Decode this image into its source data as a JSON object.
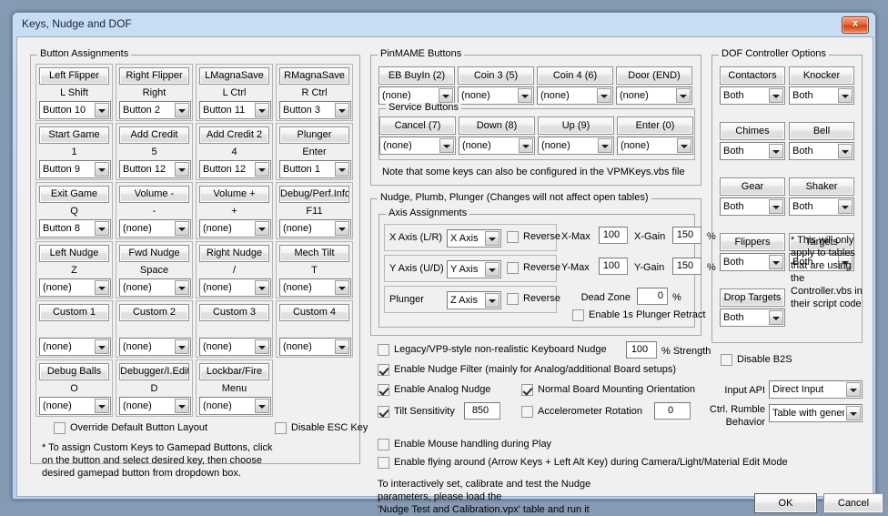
{
  "window": {
    "title": "Keys, Nudge and DOF",
    "close_label": "x"
  },
  "button_assignments": {
    "caption": "Button Assignments",
    "cells": [
      {
        "action": "Left Flipper",
        "key": "L Shift",
        "device": "Button 10"
      },
      {
        "action": "Right Flipper",
        "key": "Right",
        "device": "Button 2"
      },
      {
        "action": "LMagnaSave",
        "key": "L Ctrl",
        "device": "Button 11"
      },
      {
        "action": "RMagnaSave",
        "key": "R Ctrl",
        "device": "Button 3"
      },
      {
        "action": "Start Game",
        "key": "1",
        "device": "Button 9"
      },
      {
        "action": "Add Credit",
        "key": "5",
        "device": "Button 12"
      },
      {
        "action": "Add Credit 2",
        "key": "4",
        "device": "Button 12"
      },
      {
        "action": "Plunger",
        "key": "Enter",
        "device": "Button 1"
      },
      {
        "action": "Exit Game",
        "key": "Q",
        "device": "Button 8"
      },
      {
        "action": "Volume -",
        "key": "-",
        "device": "(none)"
      },
      {
        "action": "Volume +",
        "key": "+",
        "device": "(none)"
      },
      {
        "action": "Debug/Perf.Info",
        "key": "F11",
        "device": "(none)"
      },
      {
        "action": "Left Nudge",
        "key": "Z",
        "device": "(none)"
      },
      {
        "action": "Fwd Nudge",
        "key": "Space",
        "device": "(none)"
      },
      {
        "action": "Right Nudge",
        "key": "/",
        "device": "(none)"
      },
      {
        "action": "Mech Tilt",
        "key": "T",
        "device": "(none)"
      },
      {
        "action": "Custom 1",
        "key": "",
        "device": "(none)"
      },
      {
        "action": "Custom 2",
        "key": "",
        "device": "(none)"
      },
      {
        "action": "Custom 3",
        "key": "",
        "device": "(none)"
      },
      {
        "action": "Custom 4",
        "key": "",
        "device": "(none)"
      },
      {
        "action": "Debug Balls",
        "key": "O",
        "device": "(none)"
      },
      {
        "action": "Debugger/I.Edit",
        "key": "D",
        "device": "(none)"
      },
      {
        "action": "Lockbar/Fire",
        "key": "Menu",
        "device": "(none)"
      }
    ],
    "override_default_layout": {
      "label": "Override Default Button Layout",
      "checked": false
    },
    "disable_esc_key": {
      "label": "Disable ESC Key",
      "checked": false
    },
    "footnote": "* To assign Custom Keys to Gamepad Buttons, click\non the button and select desired key, then choose\ndesired gamepad button from dropdown box."
  },
  "pinmame": {
    "caption": "PinMAME Buttons",
    "buttons": [
      {
        "action": "EB BuyIn (2)",
        "device": "(none)"
      },
      {
        "action": "Coin 3 (5)",
        "device": "(none)"
      },
      {
        "action": "Coin 4 (6)",
        "device": "(none)"
      },
      {
        "action": "Door (END)",
        "device": "(none)"
      }
    ],
    "service": {
      "caption": "Service Buttons",
      "buttons": [
        {
          "action": "Cancel (7)",
          "device": "(none)"
        },
        {
          "action": "Down (8)",
          "device": "(none)"
        },
        {
          "action": "Up (9)",
          "device": "(none)"
        },
        {
          "action": "Enter (0)",
          "device": "(none)"
        }
      ]
    },
    "note": "Note that some keys can also be configured in the VPMKeys.vbs file"
  },
  "nudge": {
    "caption": "Nudge, Plumb, Plunger (Changes will not affect open tables)",
    "axis_caption": "Axis Assignments",
    "axes": [
      {
        "label": "X Axis (L/R)",
        "value": "X Axis",
        "reverse_label": "Reverse",
        "reverse": false,
        "max_label": "X-Max",
        "max": "100",
        "gain_label": "X-Gain",
        "gain": "150",
        "pct": "%"
      },
      {
        "label": "Y Axis (U/D)",
        "value": "Y Axis",
        "reverse_label": "Reverse",
        "reverse": false,
        "max_label": "Y-Max",
        "max": "100",
        "gain_label": "Y-Gain",
        "gain": "150",
        "pct": "%"
      },
      {
        "label": "Plunger",
        "value": "Z Axis",
        "reverse_label": "Reverse",
        "reverse": false
      }
    ],
    "dead_zone_label": "Dead Zone",
    "dead_zone": "0",
    "dead_zone_pct": "%",
    "plunger_retract": {
      "label": "Enable 1s Plunger Retract",
      "checked": false
    },
    "legacy_nudge": {
      "label": "Legacy/VP9-style non-realistic Keyboard Nudge",
      "checked": false,
      "strength": "100",
      "strength_label": "% Strength"
    },
    "nudge_filter": {
      "label": "Enable Nudge Filter (mainly for Analog/additional Board setups)",
      "checked": true
    },
    "analog_nudge": {
      "label": "Enable Analog Nudge",
      "checked": true
    },
    "board_orientation": {
      "label": "Normal Board Mounting Orientation",
      "checked": true
    },
    "tilt_sensitivity": {
      "label": "Tilt Sensitivity",
      "checked": true,
      "value": "850"
    },
    "accel_rotation": {
      "label": "Accelerometer Rotation",
      "checked": false,
      "value": "0"
    },
    "mouse_handling": {
      "label": "Enable Mouse handling during Play",
      "checked": false
    },
    "flying_around": {
      "label": "Enable flying around (Arrow Keys + Left Alt Key) during Camera/Light/Material Edit Mode",
      "checked": false
    },
    "help_text": "To interactively set, calibrate and test the Nudge\nparameters, please load the\n'Nudge Test and Calibration.vpx' table and run it"
  },
  "dof": {
    "caption": "DOF Controller Options",
    "items": [
      {
        "action": "Contactors",
        "value": "Both"
      },
      {
        "action": "Knocker",
        "value": "Both"
      },
      {
        "action": "Chimes",
        "value": "Both"
      },
      {
        "action": "Bell",
        "value": "Both"
      },
      {
        "action": "Gear",
        "value": "Both"
      },
      {
        "action": "Shaker",
        "value": "Both"
      },
      {
        "action": "Flippers",
        "value": "Both"
      },
      {
        "action": "Targets",
        "value": "Both"
      },
      {
        "action": "Drop Targets",
        "value": "Both"
      }
    ],
    "note": "* This will only\napply to tables\nthat are using the\nController.vbs in\ntheir script code",
    "disable_b2s": {
      "label": "Disable B2S",
      "checked": false
    },
    "input_api": {
      "label": "Input API",
      "value": "Direct Input"
    },
    "rumble": {
      "label": "Ctrl. Rumble\nBehavior",
      "value": "Table with generic f"
    }
  },
  "footer": {
    "ok": "OK",
    "cancel": "Cancel"
  }
}
